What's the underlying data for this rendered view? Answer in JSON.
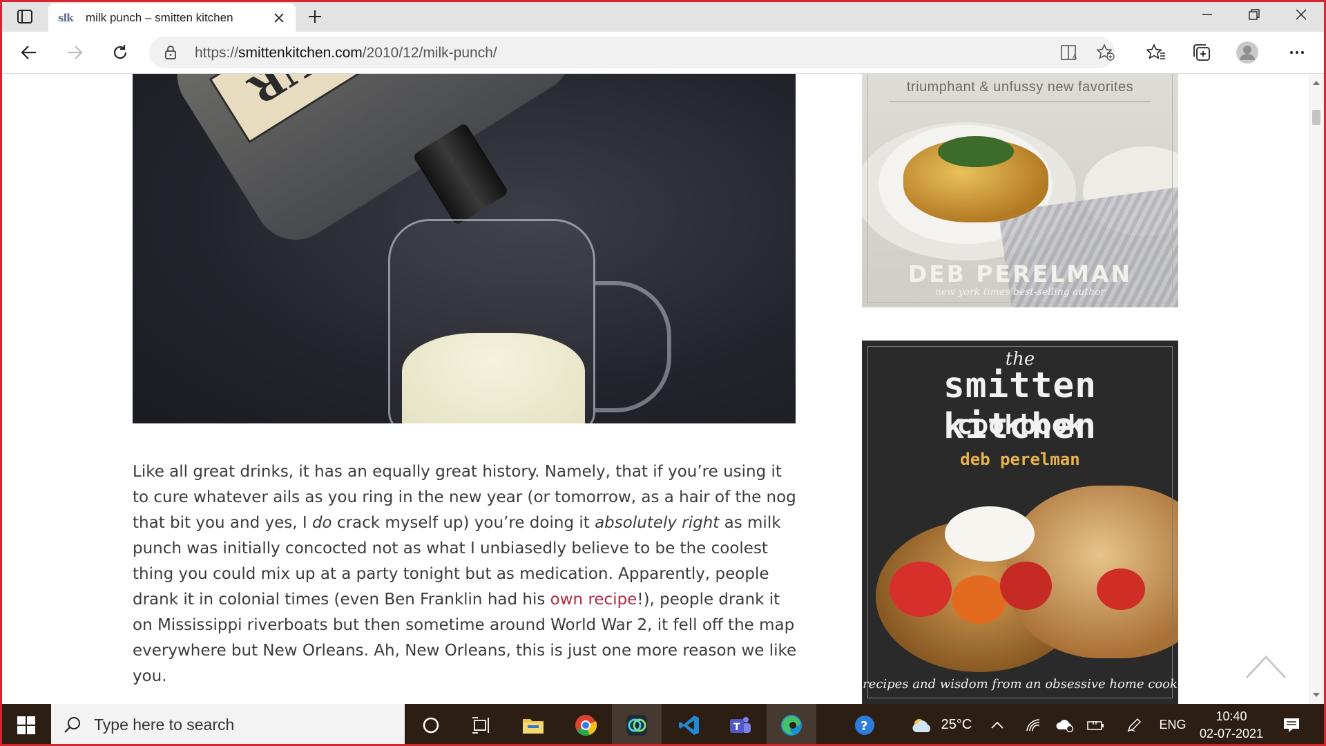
{
  "browser": {
    "tab_title": "milk punch – smitten kitchen",
    "favicon_text": "slk",
    "url_prefix": "https://",
    "url_host": "smittenkitchen.com",
    "url_path": "/2010/12/milk-punch/"
  },
  "hero_image": {
    "bottle_label_text": "BUR"
  },
  "article": {
    "p1_a": "Like all great drinks, it has an equally great history. Namely, that if you’re using it to cure whatever ails as you ring in the new year (or tomorrow, as a hair of the nog that bit you and yes, I ",
    "p1_em1": "do",
    "p1_b": " crack myself up) you’re doing it ",
    "p1_em2": "absolutely right",
    "p1_c": " as milk punch was initially concocted not as what I unbiasedly believe to be the coolest thing you could mix up at a party tonight but as medication. Apparently, people drank it in colonial times (even Ben Franklin had his ",
    "p1_link": "own recipe",
    "p1_d": "!), people drank it on Mississippi riverboats but then sometime around World War 2, it fell off the map everywhere but New Orleans. Ah, New Orleans, this is just one more reason we like you."
  },
  "sidebar": {
    "book1": {
      "tagline": "triumphant & unfussy new favorites",
      "author": "DEB PERELMAN",
      "author_sub": "new york times best-selling author"
    },
    "book2": {
      "the": "the",
      "title": "smitten kitchen",
      "subtitle": "cookbook",
      "author": "deb perelman",
      "tagline": "recipes and wisdom from an obsessive home cook"
    }
  },
  "taskbar": {
    "search_placeholder": "Type here to search",
    "weather": "25°C",
    "language": "ENG",
    "time": "10:40",
    "date": "02-07-2021"
  },
  "colors": {
    "accent_link": "#b22c3f",
    "frame": "#d9252f",
    "taskbar": "#2d1e13"
  }
}
